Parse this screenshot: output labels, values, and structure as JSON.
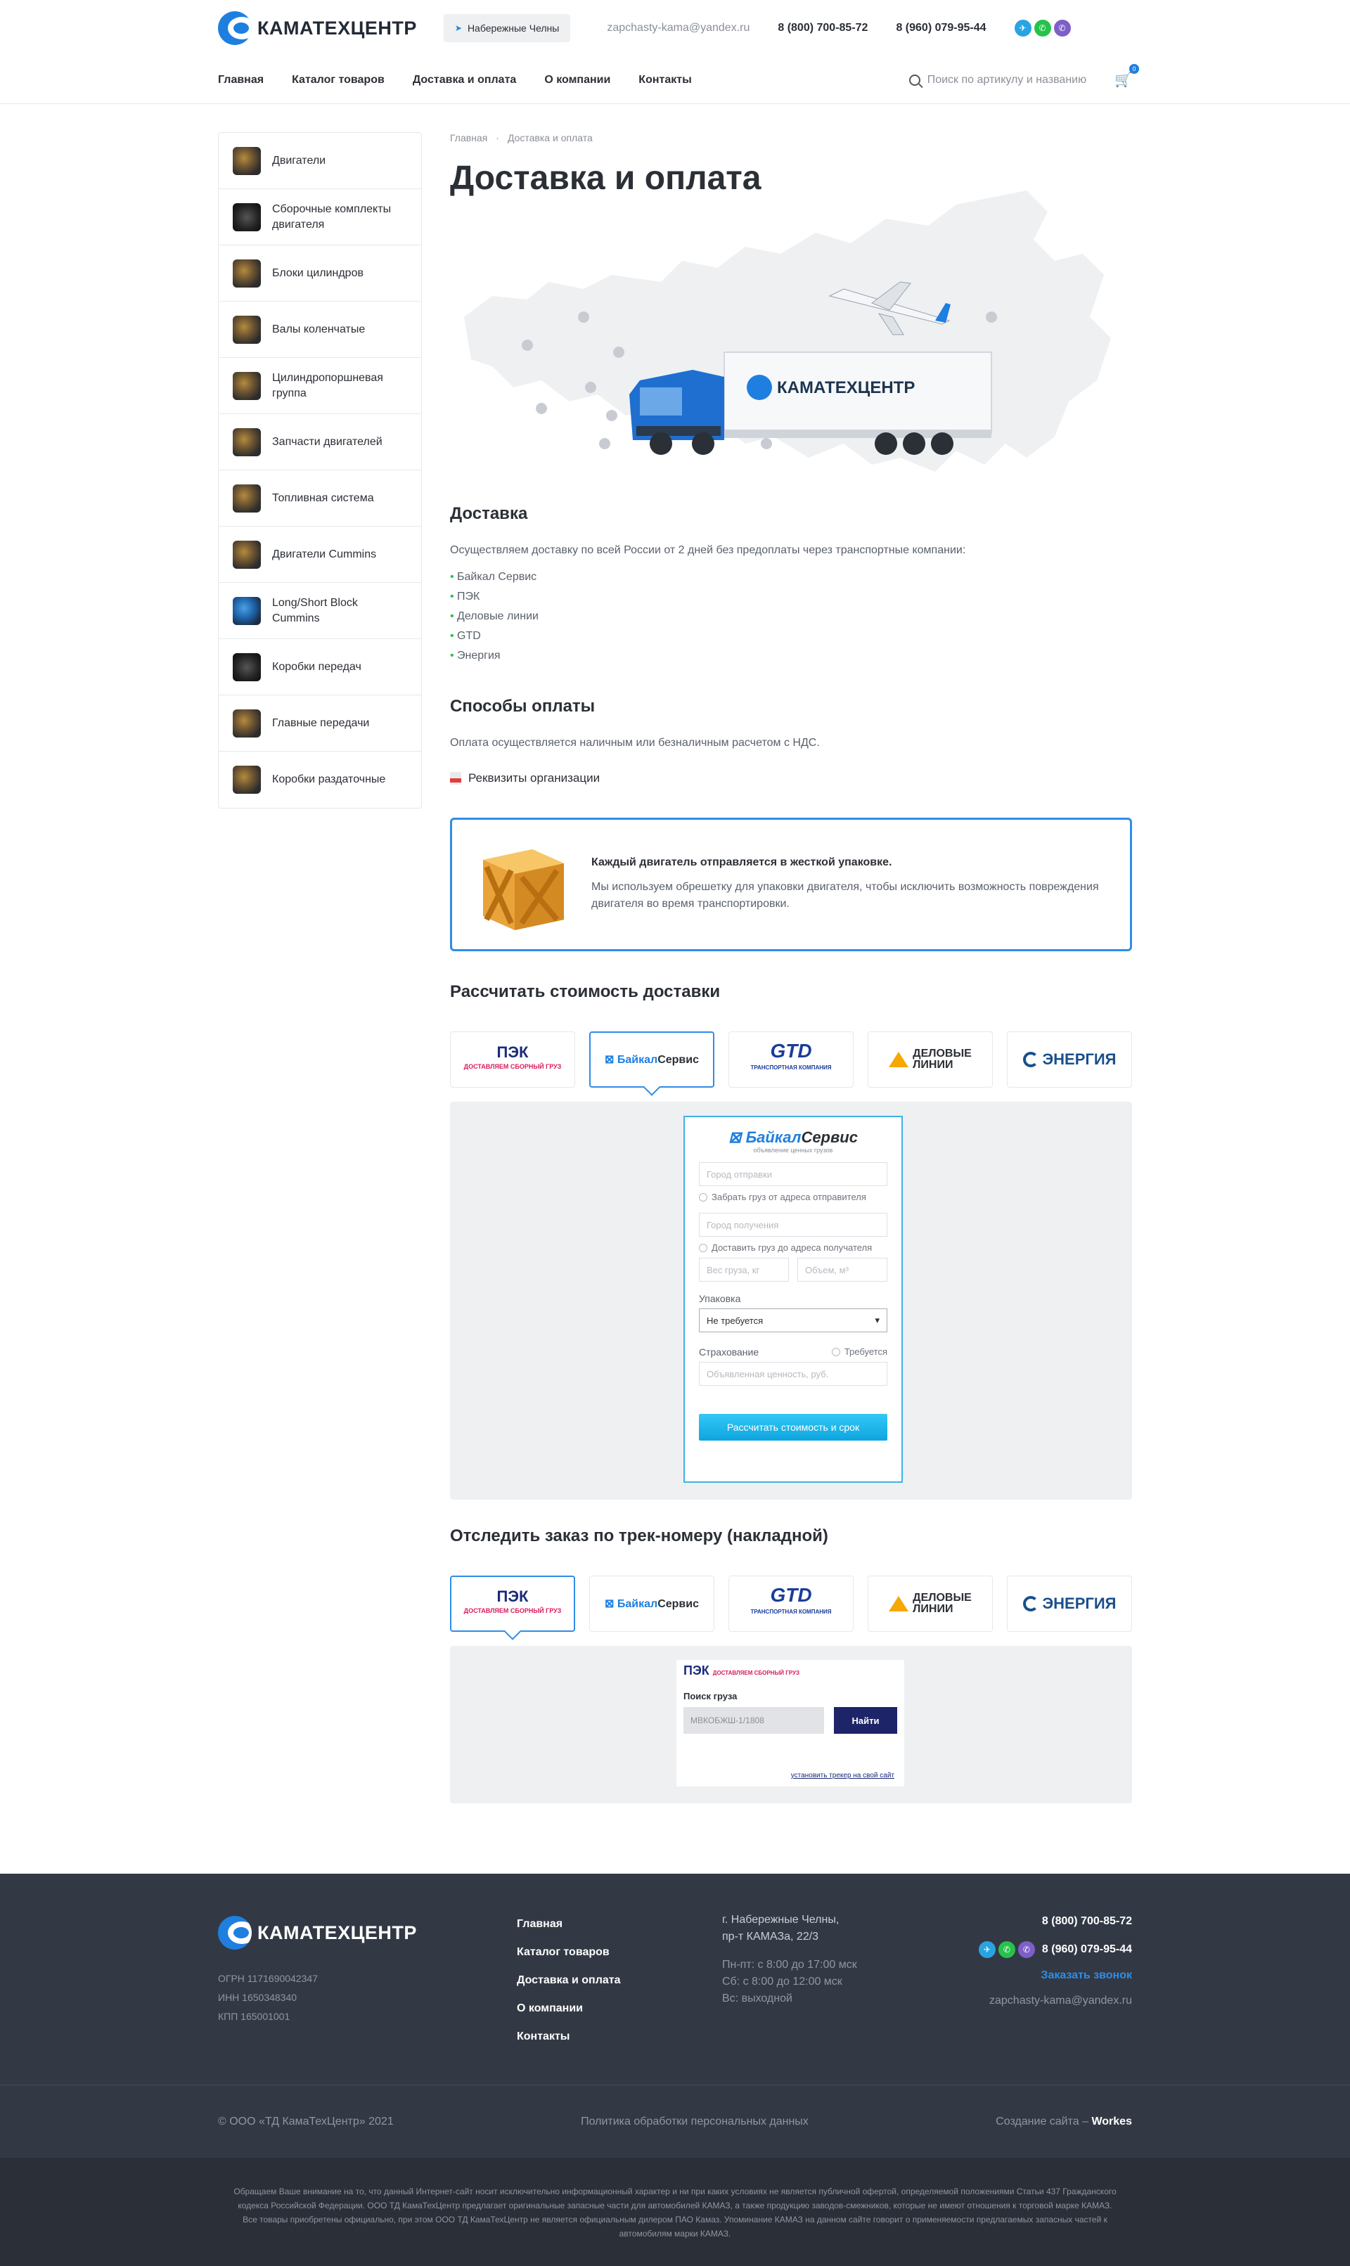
{
  "header": {
    "logo_text": "КАМАТЕХЦЕНТР",
    "city": "Набережные Челны",
    "email": "zapchasty-kama@yandex.ru",
    "phone1": "8 (800) 700-85-72",
    "phone2": "8 (960) 079-95-44",
    "messengers": [
      "telegram-icon",
      "whatsapp-icon",
      "viber-icon"
    ]
  },
  "nav": {
    "items": [
      "Главная",
      "Каталог товаров",
      "Доставка и оплата",
      "О компании",
      "Контакты"
    ],
    "search_placeholder": "Поиск по артикулу и названию",
    "cart_count": "0"
  },
  "sidebar": {
    "items": [
      "Двигатели",
      "Сборочные комплекты двигателя",
      "Блоки цилиндров",
      "Валы коленчатые",
      "Цилиндропоршневая группа",
      "Запчасти двигателей",
      "Топливная система",
      "Двигатели Cummins",
      "Long/Short Block Cummins",
      "Коробки передач",
      "Главные передачи",
      "Коробки раздаточные"
    ]
  },
  "breadcrumb": [
    "Главная",
    "Доставка и оплата"
  ],
  "page_title": "Доставка и оплата",
  "hero": {
    "truck_brand": "КАМАТЕХЦЕНТР"
  },
  "delivery": {
    "title": "Доставка",
    "text": "Осуществляем доставку по всей России от 2 дней без предоплаты через транспортные компании:",
    "companies": [
      "Байкал Сервис",
      "ПЭК",
      "Деловые линии",
      "GTD",
      "Энергия"
    ]
  },
  "payment": {
    "title": "Способы оплаты",
    "text": "Оплата осуществляется наличным или безналичным расчетом с НДС.",
    "requisites_link": "Реквизиты организации"
  },
  "packaging": {
    "title": "Каждый двигатель отправляется в жесткой упаковке.",
    "text": "Мы используем обрешетку для упаковки двигателя, чтобы исключить возможность повреждения двигателя во время транспортировки."
  },
  "calc": {
    "title": "Рассчитать стоимость доставки",
    "carriers": [
      {
        "name": "ПЭК",
        "sub": "ДОСТАВЛЯЕМ СБОРНЫЙ ГРУЗ"
      },
      {
        "name": "Байкал",
        "name2": "Сервис"
      },
      {
        "name": "GTD",
        "sub": "ТРАНСПОРТНАЯ КОМПАНИЯ"
      },
      {
        "name": "ДЕЛОВЫЕ",
        "name2": "ЛИНИИ"
      },
      {
        "name": "ЭНЕРГИЯ"
      }
    ],
    "active_carrier": 1,
    "widget": {
      "logo": "Байкал",
      "logo2": "Сервис",
      "logo_sub": "объявление ценных грузов",
      "from_placeholder": "Город отправки",
      "pickup_label": "Забрать груз от адреса отправителя",
      "to_placeholder": "Город получения",
      "delivery_label": "Доставить груз до адреса получателя",
      "weight_placeholder": "Вес груза, кг",
      "volume_placeholder": "Объем, м³",
      "packing_label": "Упаковка",
      "packing_value": "Не требуется",
      "insurance_label": "Страхование",
      "insurance_check": "Требуется",
      "declared_placeholder": "Объявленная ценность, руб.",
      "button": "Рассчитать стоимость и срок"
    }
  },
  "track": {
    "title": "Отследить заказ по трек-номеру (накладной)",
    "active_carrier": 0,
    "widget": {
      "logo": "ПЭК",
      "logo_sub": "ДОСТАВЛЯЕМ СБОРНЫЙ ГРУЗ",
      "label": "Поиск груза",
      "input_value": "МВКОБЖШ-1/1808",
      "button": "Найти",
      "link": "установить трекер на свой сайт"
    }
  },
  "footer": {
    "logo_text": "КАМАТЕХЦЕНТР",
    "ogrn": "ОГРН 1171690042347",
    "inn": "ИНН 1650348340",
    "kpp": "КПП 165001001",
    "links": [
      "Главная",
      "Каталог товаров",
      "Доставка и оплата",
      "О компании",
      "Контакты"
    ],
    "address1": "г. Набережные Челны,",
    "address2": "пр-т КАМАЗа, 22/3",
    "hours1": "Пн-пт: с 8:00 до 17:00 мск",
    "hours2": "Сб: с 8:00 до 12:00 мск",
    "hours3": "Вс: выходной",
    "phone1": "8 (800) 700-85-72",
    "phone2": "8 (960) 079-95-44",
    "callback": "Заказать звонок",
    "email": "zapchasty-kama@yandex.ru",
    "copyright": "© ООО «ТД КамаТехЦентр» 2021",
    "privacy": "Политика обработки персональных данных",
    "made_by_prefix": "Создание сайта –",
    "made_by": "Workes",
    "disclaimer": "Обращаем Ваше внимание на то, что данный Интернет-сайт носит исключительно информационный характер и ни при каких условиях не является публичной офертой, определяемой положениями Статьи 437 Гражданского кодекса Российской Федерации. ООО ТД КамаТехЦентр предлагает оригинальные запасные части для автомобилей КАМАЗ, а также продукцию заводов-смежников, которые не имеют отношения к торговой марке КАМАЗ. Все товары приобретены официально, при этом ООО ТД КамаТехЦентр не является официальным дилером ПАО Камаз. Упоминание КАМАЗ на данном сайте говорит о применяемости предлагаемых запасных частей к автомобилям марки КАМАЗ."
  },
  "colors": {
    "accent": "#2f8de6",
    "footer_bg": "#333944",
    "panel_bg": "#eef0f2"
  }
}
